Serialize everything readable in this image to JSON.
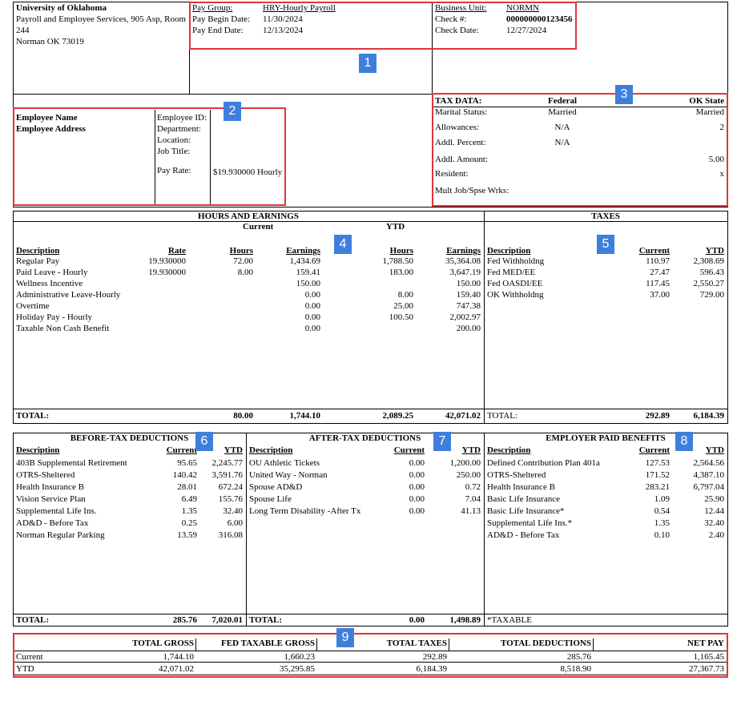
{
  "header": {
    "org_name": "University of Oklahoma",
    "org_line2": "Payroll and Employee Services, 905 Asp, Room",
    "org_line3": "244",
    "org_line4": "Norman OK 73019",
    "pay_group_label": "Pay Group:",
    "pay_group_value": "HRY-Hourly Payroll",
    "pay_begin_label": "Pay Begin Date:",
    "pay_begin_value": "11/30/2024",
    "pay_end_label": "Pay End Date:",
    "pay_end_value": "12/13/2024",
    "bu_label": "Business Unit:",
    "bu_value": "NORMN",
    "check_label": "Check #:",
    "check_value": "000000000123456",
    "check_date_label": "Check Date:",
    "check_date_value": "12/27/2024"
  },
  "employee": {
    "name_label": "Employee Name",
    "address_label": "Employee Address",
    "id_label": "Employee ID:",
    "dept_label": "Department:",
    "loc_label": "Location:",
    "title_label": "Job Title:",
    "rate_label": "Pay Rate:",
    "rate_value": "$19.930000 Hourly"
  },
  "tax_data": {
    "title": "TAX DATA:",
    "federal": "Federal",
    "state": "OK State",
    "rows": [
      {
        "label": "Marital Status:",
        "fed": "Married",
        "state": "Married"
      },
      {
        "label": "Allowances:",
        "fed": "N/A",
        "state": "2"
      },
      {
        "label": "Addl. Percent:",
        "fed": "N/A",
        "state": ""
      },
      {
        "label": "Addl. Amount:",
        "fed": "",
        "state": "5.00"
      },
      {
        "label": "Resident:",
        "fed": "",
        "state": "x"
      },
      {
        "label": "Mult Job/Spse Wrks:",
        "fed": "",
        "state": ""
      }
    ]
  },
  "earnings": {
    "title": "HOURS AND EARNINGS",
    "current": "Current",
    "ytd": "YTD",
    "h_desc": "Description",
    "h_rate": "Rate",
    "h_hours": "Hours",
    "h_earn": "Earnings",
    "rows": [
      {
        "desc": "Regular Pay",
        "rate": "19.930000",
        "hours": "72.00",
        "earn": "1,434.69",
        "yhours": "1,788.50",
        "yearn": "35,364.08"
      },
      {
        "desc": "Paid Leave - Hourly",
        "rate": "19.930000",
        "hours": "8.00",
        "earn": "159.41",
        "yhours": "183.00",
        "yearn": "3,647.19"
      },
      {
        "desc": "Wellness Incentive",
        "rate": "",
        "hours": "",
        "earn": "150.00",
        "yhours": "",
        "yearn": "150.00"
      },
      {
        "desc": "Administrative Leave-Hourly",
        "rate": "",
        "hours": "",
        "earn": "0.00",
        "yhours": "8.00",
        "yearn": "159.40"
      },
      {
        "desc": "Overtime",
        "rate": "",
        "hours": "",
        "earn": "0.00",
        "yhours": "25.00",
        "yearn": "747.38"
      },
      {
        "desc": "Holiday Pay - Hourly",
        "rate": "",
        "hours": "",
        "earn": "0.00",
        "yhours": "100.50",
        "yearn": "2,002.97"
      },
      {
        "desc": "Taxable Non Cash Benefit",
        "rate": "",
        "hours": "",
        "earn": "0.00",
        "yhours": "",
        "yearn": "200.00"
      }
    ],
    "total_label": "TOTAL:",
    "total_hours": "80.00",
    "total_earn": "1,744.10",
    "total_yhours": "2,089.25",
    "total_yearn": "42,071.02"
  },
  "taxes": {
    "title": "TAXES",
    "h_desc": "Description",
    "h_current": "Current",
    "h_ytd": "YTD",
    "rows": [
      {
        "desc": "Fed Withholdng",
        "current": "110.97",
        "ytd": "2,308.69"
      },
      {
        "desc": "Fed MED/EE",
        "current": "27.47",
        "ytd": "596.43"
      },
      {
        "desc": "Fed OASDI/EE",
        "current": "117.45",
        "ytd": "2,550.27"
      },
      {
        "desc": "OK Withholdng",
        "current": "37.00",
        "ytd": "729.00"
      }
    ],
    "total_label": "TOTAL:",
    "total_current": "292.89",
    "total_ytd": "6,184.39"
  },
  "before_tax": {
    "title": "BEFORE-TAX DEDUCTIONS",
    "h_desc": "Description",
    "h_current": "Current",
    "h_ytd": "YTD",
    "rows": [
      {
        "desc": "403B Supplemental Retirement",
        "current": "95.65",
        "ytd": "2,245.77"
      },
      {
        "desc": "OTRS-Sheltered",
        "current": "140.42",
        "ytd": "3,591.76"
      },
      {
        "desc": "Health Insurance B",
        "current": "28.01",
        "ytd": "672.24"
      },
      {
        "desc": "Vision Service Plan",
        "current": "6.49",
        "ytd": "155.76"
      },
      {
        "desc": "Supplemental Life Ins.",
        "current": "1.35",
        "ytd": "32.40"
      },
      {
        "desc": "AD&D - Before Tax",
        "current": "0.25",
        "ytd": "6.00"
      },
      {
        "desc": "Norman Regular Parking",
        "current": "13.59",
        "ytd": "316.08"
      }
    ],
    "total_label": "TOTAL:",
    "total_current": "285.76",
    "total_ytd": "7,020.01"
  },
  "after_tax": {
    "title": "AFTER-TAX DEDUCTIONS",
    "h_desc": "Description",
    "h_current": "Current",
    "h_ytd": "YTD",
    "rows": [
      {
        "desc": "OU Athletic Tickets",
        "current": "0.00",
        "ytd": "1,200.00"
      },
      {
        "desc": "United Way - Norman",
        "current": "0.00",
        "ytd": "250.00"
      },
      {
        "desc": "Spouse AD&D",
        "current": "0.00",
        "ytd": "0.72"
      },
      {
        "desc": "Spouse Life",
        "current": "0.00",
        "ytd": "7.04"
      },
      {
        "desc": "Long Term Disability -After Tx",
        "current": "0.00",
        "ytd": "41.13"
      }
    ],
    "total_label": "TOTAL:",
    "total_current": "0.00",
    "total_ytd": "1,498.89"
  },
  "employer": {
    "title": "EMPLOYER PAID BENEFITS",
    "h_desc": "Description",
    "h_current": "Current",
    "h_ytd": "YTD",
    "rows": [
      {
        "desc": "Defined Contribution Plan 401a",
        "current": "127.53",
        "ytd": "2,564.56"
      },
      {
        "desc": "OTRS-Sheltered",
        "current": "171.52",
        "ytd": "4,387.10"
      },
      {
        "desc": "Health Insurance B",
        "current": "283.21",
        "ytd": "6,797.04"
      },
      {
        "desc": "Basic Life Insurance",
        "current": "1.09",
        "ytd": "25.90"
      },
      {
        "desc": "Basic Life Insurance*",
        "current": "0.54",
        "ytd": "12.44"
      },
      {
        "desc": "Supplemental Life Ins.*",
        "current": "1.35",
        "ytd": "32.40"
      },
      {
        "desc": "AD&D - Before Tax",
        "current": "0.10",
        "ytd": "2.40"
      }
    ],
    "taxable_note": "*TAXABLE"
  },
  "summary": {
    "h_gross": "TOTAL GROSS",
    "h_fed": "FED TAXABLE GROSS",
    "h_taxes": "TOTAL TAXES",
    "h_ded": "TOTAL DEDUCTIONS",
    "h_net": "NET PAY",
    "current_label": "Current",
    "ytd_label": "YTD",
    "current": {
      "gross": "1,744.10",
      "fed": "1,660.23",
      "taxes": "292.89",
      "ded": "285.76",
      "net": "1,165.45"
    },
    "ytd": {
      "gross": "42,071.02",
      "fed": "35,295.85",
      "taxes": "6,184.39",
      "ded": "8,518.90",
      "net": "27,367.73"
    }
  },
  "badges": [
    "1",
    "2",
    "3",
    "4",
    "5",
    "6",
    "7",
    "8",
    "9"
  ]
}
